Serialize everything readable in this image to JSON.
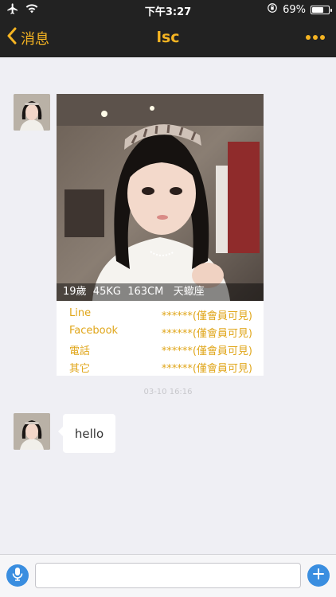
{
  "status_bar": {
    "time": "下午3:27",
    "battery_percent": "69%",
    "battery_level": 0.69,
    "icons": [
      "airplane-icon",
      "wifi-icon",
      "orientation-lock-icon",
      "battery-icon"
    ]
  },
  "nav": {
    "back_label": "消息",
    "title": "lsc",
    "more_icon": "more-dots-icon",
    "accent_color": "#f5b422",
    "bar_color": "#222222"
  },
  "profile_card": {
    "stats": "19歲  45KG  163CM   天蠍座",
    "contacts": [
      {
        "label": "Line",
        "value": "******(僅會員可見)"
      },
      {
        "label": "Facebook",
        "value": "******(僅會員可見)"
      },
      {
        "label": "電話",
        "value": "******(僅會員可見)"
      },
      {
        "label": "其它",
        "value": "******(僅會員可見)"
      }
    ]
  },
  "messages": {
    "timestamp": "03-10 16:16",
    "text_message": "hello"
  },
  "input_bar": {
    "placeholder": "",
    "value": "",
    "button_color": "#3a8ee0"
  }
}
